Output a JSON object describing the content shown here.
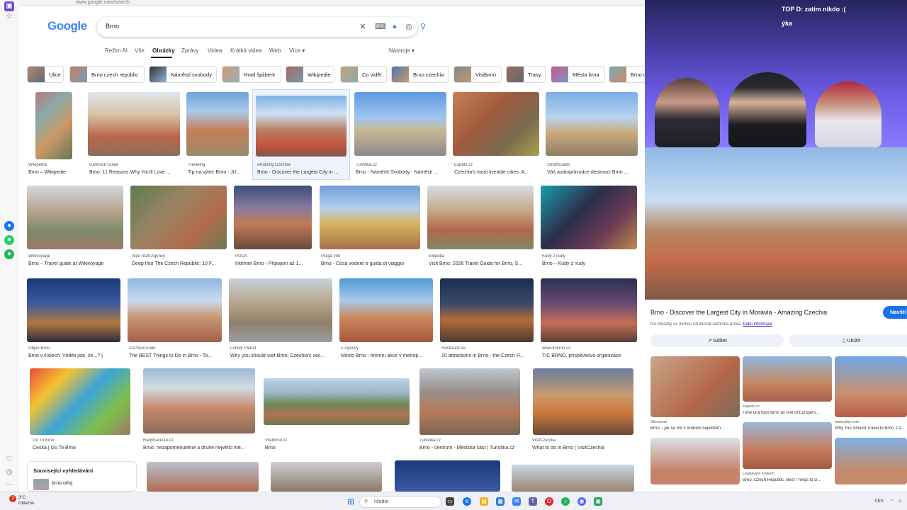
{
  "browser": {
    "url_text": "www.google.com/search",
    "logo": "Google",
    "search": {
      "query": "Brno"
    },
    "tabs": [
      "Režim AI",
      "Vše",
      "Obrázky",
      "Zprávy",
      "Videa",
      "Krátká videa",
      "Web",
      "Více ▾"
    ],
    "active_tab": "Obrázky",
    "tools_label": "Nástroje ▾",
    "chips": [
      "Ulice",
      "Brno czech republic",
      "Náměstí svobody",
      "Hrad špilberk",
      "Wikipedie",
      "Co vidět",
      "Brno czechia",
      "Visitbrno",
      "Trasy",
      "Města brna",
      "Brno c"
    ],
    "results": [
      {
        "src": "Wikipedia",
        "title": "Brno – Wikipedie"
      },
      {
        "src": "Giverock Guide",
        "title": "Brno: 11 Reasons Why You'll Love ..."
      },
      {
        "src": "Traveling",
        "title": "Tip na výlet: Brno - Již..."
      },
      {
        "src": "Amazing Czechia",
        "title": "Brno - Discover the Largest City in ..."
      },
      {
        "src": "Turistika.cz",
        "title": "Brno - Náměstí Svobody - Náměstí ..."
      },
      {
        "src": "Expats.cz",
        "title": "Czechia's most liveable cities: A..."
      },
      {
        "src": "SmartGuide",
        "title": "Váš audioprůvodce destinací Brno ..."
      },
      {
        "src": "Wikivoyage",
        "title": "Brno – Travel guide at Wikivoyage"
      },
      {
        "src": "Alex Staff Agency",
        "title": "Deep Into The Czech Republic: 10 F..."
      },
      {
        "src": "PODA",
        "title": "Internet Brno - Připojení až 1..."
      },
      {
        "src": "Praga info",
        "title": "Brno - Cosa vedere e guida di viaggio"
      },
      {
        "src": "Expedia",
        "title": "Visit Brno: 2026 Travel Guide for Brno, S..."
      },
      {
        "src": "Kudy z nudy",
        "title": "Brno – Kudy z nudy"
      },
      {
        "src": "Objev Brno",
        "title": "Brno v číslech: Věděli jste, že...? |"
      },
      {
        "src": "CetYourGuide",
        "title": "The BEST Things to Do in Brno - To..."
      },
      {
        "src": "Lonely Planet",
        "title": "Why you should visit Brno, Czechia's sec..."
      },
      {
        "src": "Z Agency",
        "title": "Město Brno - firemní akce v metrop..."
      },
      {
        "src": "Rucksack se",
        "title": "10 attractions in Brno - the Czech R..."
      },
      {
        "src": "www.ticbrno.cz",
        "title": "TIC BRNO, příspěvková organizace"
      },
      {
        "src": "Go To Brno",
        "title": "Česká | Go To Brno"
      },
      {
        "src": "Radynacestu.cz",
        "title": "Brno: nezapomenutelné a druhé největší mě..."
      },
      {
        "src": "VisitBrno.cz",
        "title": "Brno"
      },
      {
        "src": "Turistika.cz",
        "title": "Brno - centrum - Městská část | Turistika.cz"
      },
      {
        "src": "VisitCzechia",
        "title": "What to do in Brno | VisitCzechia"
      }
    ],
    "related": {
      "heading": "Související vyhledávání",
      "item": "brno orloj"
    }
  },
  "stream": {
    "overlay_text": "TOP D: zatím nikdo :(",
    "overlay_text2": "ýka"
  },
  "panel": {
    "title": "Brno - Discover the Largest City in Moravia - Amazing Czechia",
    "visit": "Navští",
    "note": "Na obrázky se mohou vztahovat autorská práva.",
    "note_link": "Další informace",
    "share": "Sdílet",
    "save": "Uložit",
    "related": [
      {
        "src": "Slevomat",
        "title": "Brno – jak se mít v druhém největším..."
      },
      {
        "src": "Expats.cz",
        "title": "Time Out tops Brno as one of Europe's..."
      },
      {
        "src": "www.afar.com",
        "title": "Why You Should Travel to Brno, Cz..."
      },
      {
        "src": "",
        "title": ""
      },
      {
        "src": "Loudavým krokem",
        "title": "Brno, Czech Republic: Best Things to D..."
      },
      {
        "src": "",
        "title": ""
      }
    ]
  },
  "taskbar": {
    "weather_temp": "3°C",
    "weather_desc": "Oblačno",
    "search": "Hledat",
    "tray": "CES"
  },
  "colors": {
    "accent": "#1a73e8",
    "stream_purple": "#6c5ce6"
  }
}
